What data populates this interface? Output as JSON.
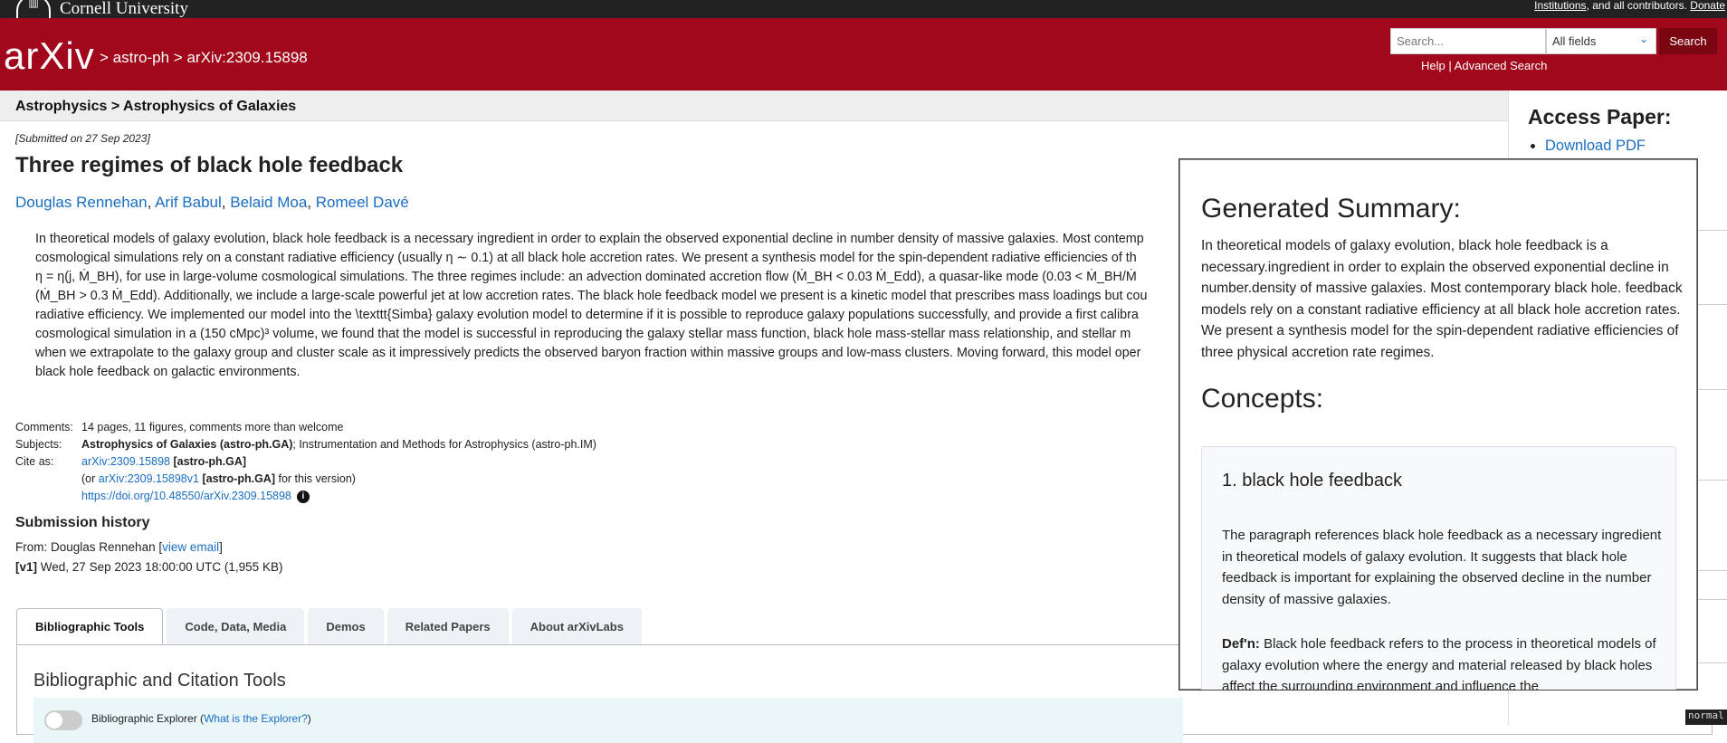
{
  "topbar": {
    "university": "Cornell University",
    "right_prefix": "Institutions",
    "right_middle": ", and all contributors.",
    "donate": "Donate"
  },
  "header": {
    "logo": "arXiv",
    "crumb_sep": ">",
    "crumb1": "astro-ph",
    "crumb2": "arXiv:2309.15898"
  },
  "search": {
    "placeholder": "Search...",
    "field": "All fields",
    "button": "Search",
    "help": "Help",
    "sep": "|",
    "advanced": "Advanced Search"
  },
  "subbar": {
    "text": "Astrophysics > Astrophysics of Galaxies"
  },
  "paper": {
    "dateline": "[Submitted on 27 Sep 2023]",
    "title": "Three regimes of black hole feedback",
    "authors": [
      "Douglas Rennehan",
      "Arif Babul",
      "Belaid Moa",
      "Romeel Davé"
    ],
    "abstract": [
      "In theoretical models of galaxy evolution, black hole feedback is a necessary ingredient in order to explain the observed exponential decline in number density of massive galaxies. Most contemp",
      "cosmological simulations rely on a constant radiative efficiency (usually η ∼ 0.1) at all black hole accretion rates. We present a synthesis model for the spin-dependent radiative efficiencies of th",
      "η = η(j, Ṁ_BH), for use in large-volume cosmological simulations. The three regimes include: an advection dominated accretion flow (Ṁ_BH < 0.03 Ṁ_Edd), a quasar-like mode (0.03 < Ṁ_BH/Ṁ",
      "(Ṁ_BH > 0.3 Ṁ_Edd). Additionally, we include a large-scale powerful jet at low accretion rates. The black hole feedback model we present is a kinetic model that prescribes mass loadings but cou",
      "radiative efficiency. We implemented our model into the \\texttt{Simba} galaxy evolution model to determine if it is possible to reproduce galaxy populations successfully, and provide a first calibra",
      "cosmological simulation in a (150 cMpc)³ volume, we found that the model is successful in reproducing the galaxy stellar mass function, black hole mass-stellar mass relationship, and stellar m",
      "when we extrapolate to the galaxy group and cluster scale as it impressively predicts the observed baryon fraction within massive groups and low-mass clusters. Moving forward, this model oper",
      "black hole feedback on galactic environments."
    ],
    "comments_label": "Comments:",
    "comments": "14 pages, 11 figures, comments more than welcome",
    "subjects_label": "Subjects:",
    "subjects_bold": "Astrophysics of Galaxies (astro-ph.GA)",
    "subjects_rest": "; Instrumentation and Methods for Astrophysics (astro-ph.IM)",
    "cite_label": "Cite as:",
    "cite_link": "arXiv:2309.15898",
    "cite_tag": "[astro-ph.GA]",
    "cite2_pre": "(or",
    "cite2_link": "arXiv:2309.15898v1",
    "cite2_tag": "[astro-ph.GA]",
    "cite2_post": "for this version)",
    "doi": "https://doi.org/10.48550/arXiv.2309.15898",
    "history_title": "Submission history",
    "from_pre": "From: Douglas Rennehan [",
    "from_link": "view email",
    "from_post": "]",
    "v1_tag": "[v1]",
    "v1_text": "Wed, 27 Sep 2023 18:00:00 UTC (1,955 KB)"
  },
  "tabs": [
    "Bibliographic Tools",
    "Code, Data, Media",
    "Demos",
    "Related Papers",
    "About arXivLabs"
  ],
  "tools": {
    "title": "Bibliographic and Citation Tools",
    "explorer_pre": "Bibliographic Explorer (",
    "explorer_link": "What is the Explorer?",
    "explorer_post": ")"
  },
  "side": {
    "title": "Access Paper:",
    "download": "Download PDF"
  },
  "popup": {
    "summary_title": "Generated Summary:",
    "summary": "In theoretical models of galaxy evolution, black hole feedback is a necessary.ingredient in order to explain the observed exponential decline in number.density of massive galaxies. Most contemporary black hole. feedback models rely on a constant radiative efficiency at all black hole accretion rates. We present a synthesis model for the spin-dependent radiative efficiencies of three physical accretion rate regimes.",
    "concepts_title": "Concepts:",
    "concept1_title": "1. black hole feedback",
    "concept1_text": "The paragraph references black hole feedback as a necessary ingredient in theoretical models of galaxy evolution. It suggests that black hole feedback is important for explaining the observed decline in the number density of massive galaxies.",
    "concept1_defn_label": "Def'n:",
    "concept1_defn": "Black hole feedback refers to the process in theoretical models of galaxy evolution where the energy and material released by black holes affect the surrounding environment and influence the"
  },
  "status": {
    "mode": "normal"
  }
}
